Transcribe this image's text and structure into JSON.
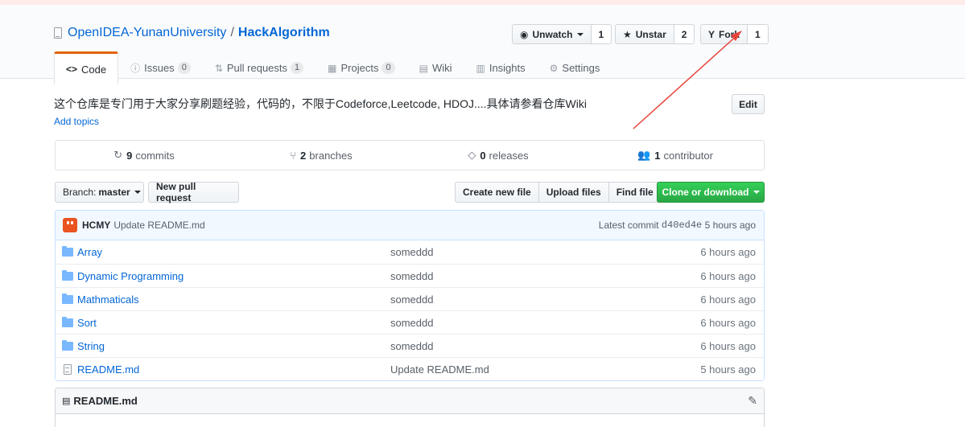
{
  "repo": {
    "owner": "OpenIDEA-YunanUniversity",
    "separator": "/",
    "name": "HackAlgorithm"
  },
  "actions": {
    "watch": {
      "label": "Unwatch",
      "count": "1",
      "icon": "eye-icon"
    },
    "star": {
      "label": "Unstar",
      "count": "2",
      "icon": "star-icon"
    },
    "fork": {
      "label": "Fork",
      "count": "1",
      "icon": "fork-icon"
    }
  },
  "tabs": [
    {
      "label": "Code",
      "icon": "code-icon",
      "selected": true
    },
    {
      "label": "Issues",
      "count": "0",
      "icon": "issue-icon"
    },
    {
      "label": "Pull requests",
      "count": "1",
      "icon": "pull-request-icon"
    },
    {
      "label": "Projects",
      "count": "0",
      "icon": "project-icon"
    },
    {
      "label": "Wiki",
      "icon": "wiki-icon"
    },
    {
      "label": "Insights",
      "icon": "graph-icon"
    },
    {
      "label": "Settings",
      "icon": "gear-icon"
    }
  ],
  "description": "这个仓库是专门用于大家分享刷题经验，代码的，不限于Codeforce,Leetcode, HDOJ....具体请参看仓库Wiki",
  "add_topics": "Add topics",
  "edit_label": "Edit",
  "summary": {
    "commits": {
      "count": "9",
      "label": "commits"
    },
    "branches": {
      "count": "2",
      "label": "branches"
    },
    "releases": {
      "count": "0",
      "label": "releases"
    },
    "contributors": {
      "count": "1",
      "label": "contributor"
    }
  },
  "toolbar": {
    "branch_prefix": "Branch:",
    "branch": "master",
    "new_pr": "New pull request",
    "create_file": "Create new file",
    "upload_files": "Upload files",
    "find_file": "Find file",
    "clone": "Clone or download"
  },
  "latest_commit": {
    "author": "HCMY",
    "message": "Update README.md",
    "prefix": "Latest commit",
    "sha": "d40ed4e",
    "age": "5 hours ago"
  },
  "files": [
    {
      "name": "Array",
      "type": "folder",
      "message": "someddd",
      "age": "6 hours ago"
    },
    {
      "name": "Dynamic Programming",
      "type": "folder",
      "message": "someddd",
      "age": "6 hours ago"
    },
    {
      "name": "Mathmaticals",
      "type": "folder",
      "message": "someddd",
      "age": "6 hours ago"
    },
    {
      "name": "Sort",
      "type": "folder",
      "message": "someddd",
      "age": "6 hours ago"
    },
    {
      "name": "String",
      "type": "folder",
      "message": "someddd",
      "age": "6 hours ago"
    },
    {
      "name": "README.md",
      "type": "file",
      "message": "Update README.md",
      "age": "5 hours ago"
    }
  ],
  "readme": {
    "title": "README.md"
  },
  "colors": {
    "link": "#0366d6",
    "tab_accent": "#e36209",
    "clone_green": "#28a745",
    "annotation_arrow": "#e8433a"
  }
}
